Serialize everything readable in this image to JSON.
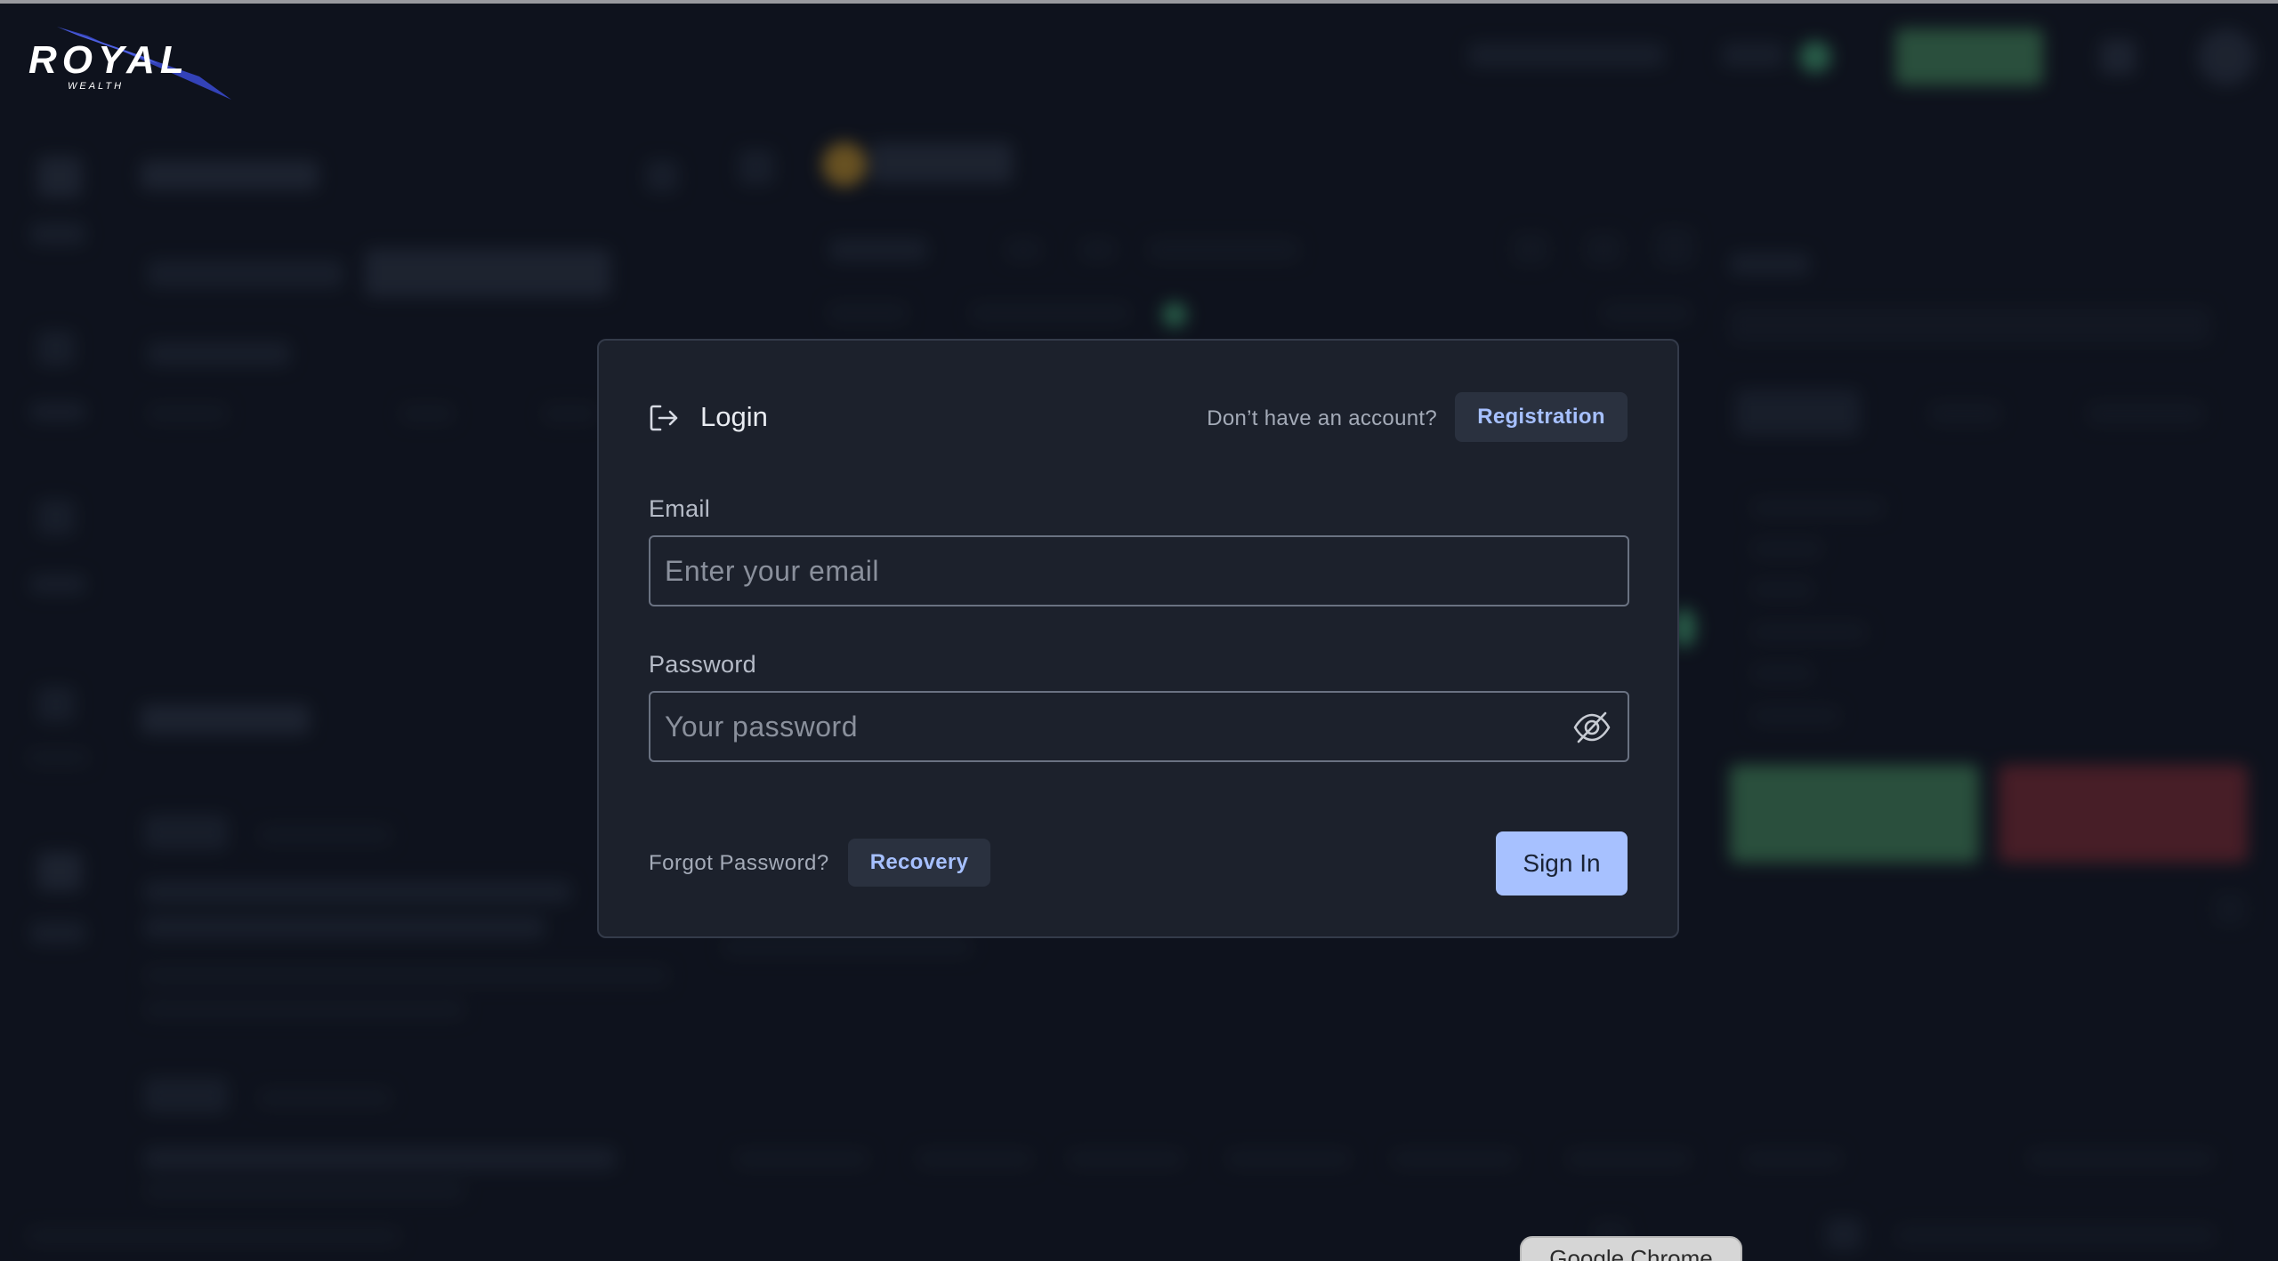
{
  "logo": {
    "brand": "ROYAL",
    "tagline": "WEALTH"
  },
  "colors": {
    "background": "#131824",
    "modal_background": "#1c212c",
    "accent": "#a7c1ff",
    "link": "#a6c0ff",
    "logo_blue": "#3342b8"
  },
  "login_modal": {
    "icon": "login-arrow-icon",
    "title": "Login",
    "no_account_text": "Don’t have an account?",
    "registration_label": "Registration",
    "email": {
      "label": "Email",
      "placeholder": "Enter your email",
      "value": ""
    },
    "password": {
      "label": "Password",
      "placeholder": "Your password",
      "value": "",
      "toggle_icon": "eye-off-icon"
    },
    "forgot_text": "Forgot Password?",
    "recovery_label": "Recovery",
    "signin_label": "Sign In"
  },
  "tooltip": {
    "text": "Google Chrome"
  }
}
